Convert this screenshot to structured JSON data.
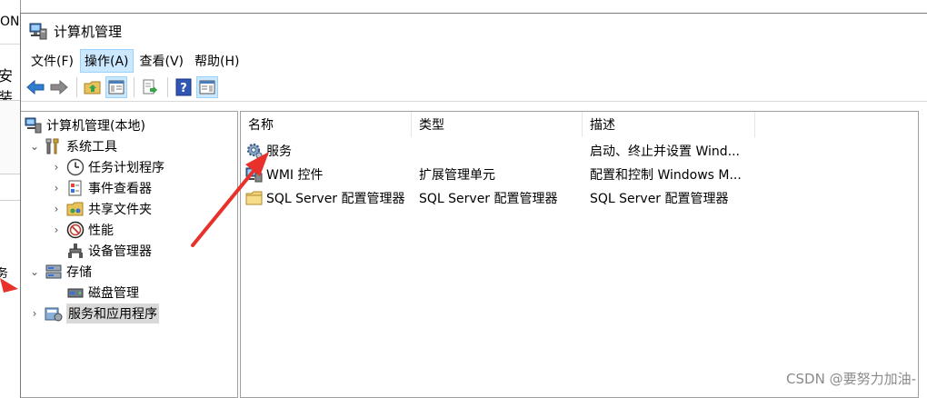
{
  "background_window": {
    "title_fragment": "ON",
    "text_fragment": "安装",
    "side_fragment": "务"
  },
  "window": {
    "title": "计算机管理"
  },
  "menu": [
    {
      "label": "文件(F)"
    },
    {
      "label": "操作(A)"
    },
    {
      "label": "查看(V)"
    },
    {
      "label": "帮助(H)"
    }
  ],
  "toolbar_icons": [
    "back-arrow-icon",
    "forward-arrow-icon",
    "up-folder-icon",
    "show-hide-tree-icon",
    "export-list-icon",
    "help-icon",
    "action-pane-icon"
  ],
  "tree": {
    "root": "计算机管理(本地)",
    "system_tools": "系统工具",
    "task_scheduler": "任务计划程序",
    "event_viewer": "事件查看器",
    "shared_folders": "共享文件夹",
    "performance": "性能",
    "device_manager": "设备管理器",
    "storage": "存储",
    "disk_management": "磁盘管理",
    "services_apps": "服务和应用程序"
  },
  "list": {
    "headers": {
      "name": "名称",
      "type": "类型",
      "description": "描述"
    },
    "rows": [
      {
        "name": "服务",
        "type": "",
        "description": "启动、终止并设置 Wind..."
      },
      {
        "name": "WMI 控件",
        "type": "扩展管理单元",
        "description": "配置和控制 Windows M..."
      },
      {
        "name": "SQL Server 配置管理器",
        "type": "SQL Server 配置管理器",
        "description": "SQL Server 配置管理器"
      }
    ]
  },
  "watermark": "CSDN @要努力加油-",
  "colors": {
    "selection_bg": "#cce8ff",
    "tree_selected_bg": "#d9d9d9",
    "annotation_red": "#e8312a"
  }
}
